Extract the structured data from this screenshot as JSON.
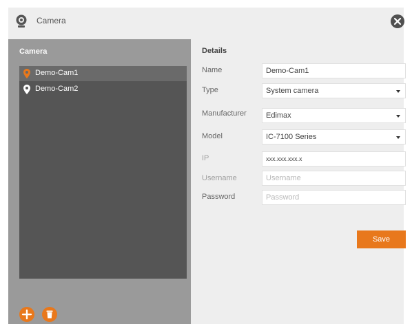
{
  "window": {
    "title": "Camera",
    "icon": "webcam-icon",
    "close_icon": "close-icon"
  },
  "camera_panel": {
    "title": "Camera",
    "items": [
      {
        "label": "Demo-Cam1",
        "selected": true,
        "icon": "location-pin-icon",
        "icon_color": "#e8781c"
      },
      {
        "label": "Demo-Cam2",
        "selected": false,
        "icon": "location-pin-icon",
        "icon_color": "#ffffff"
      }
    ],
    "add_icon": "add-icon",
    "delete_icon": "trash-icon"
  },
  "details": {
    "title": "Details",
    "name": {
      "label": "Name",
      "value": "Demo-Cam1"
    },
    "type": {
      "label": "Type",
      "value": "System camera"
    },
    "manufacturer": {
      "label": "Manufacturer",
      "value": "Edimax"
    },
    "model": {
      "label": "Model",
      "value": "IC-7100 Series"
    },
    "ip": {
      "label": "IP",
      "value": "xxx.xxx.xxx.x"
    },
    "username": {
      "label": "Username",
      "placeholder": "Username"
    },
    "password": {
      "label": "Password",
      "placeholder": "Password"
    },
    "save_label": "Save"
  },
  "colors": {
    "accent": "#e8781c",
    "panel": "#9a9a9a",
    "list": "#555555",
    "dialog": "#eeeeee"
  }
}
